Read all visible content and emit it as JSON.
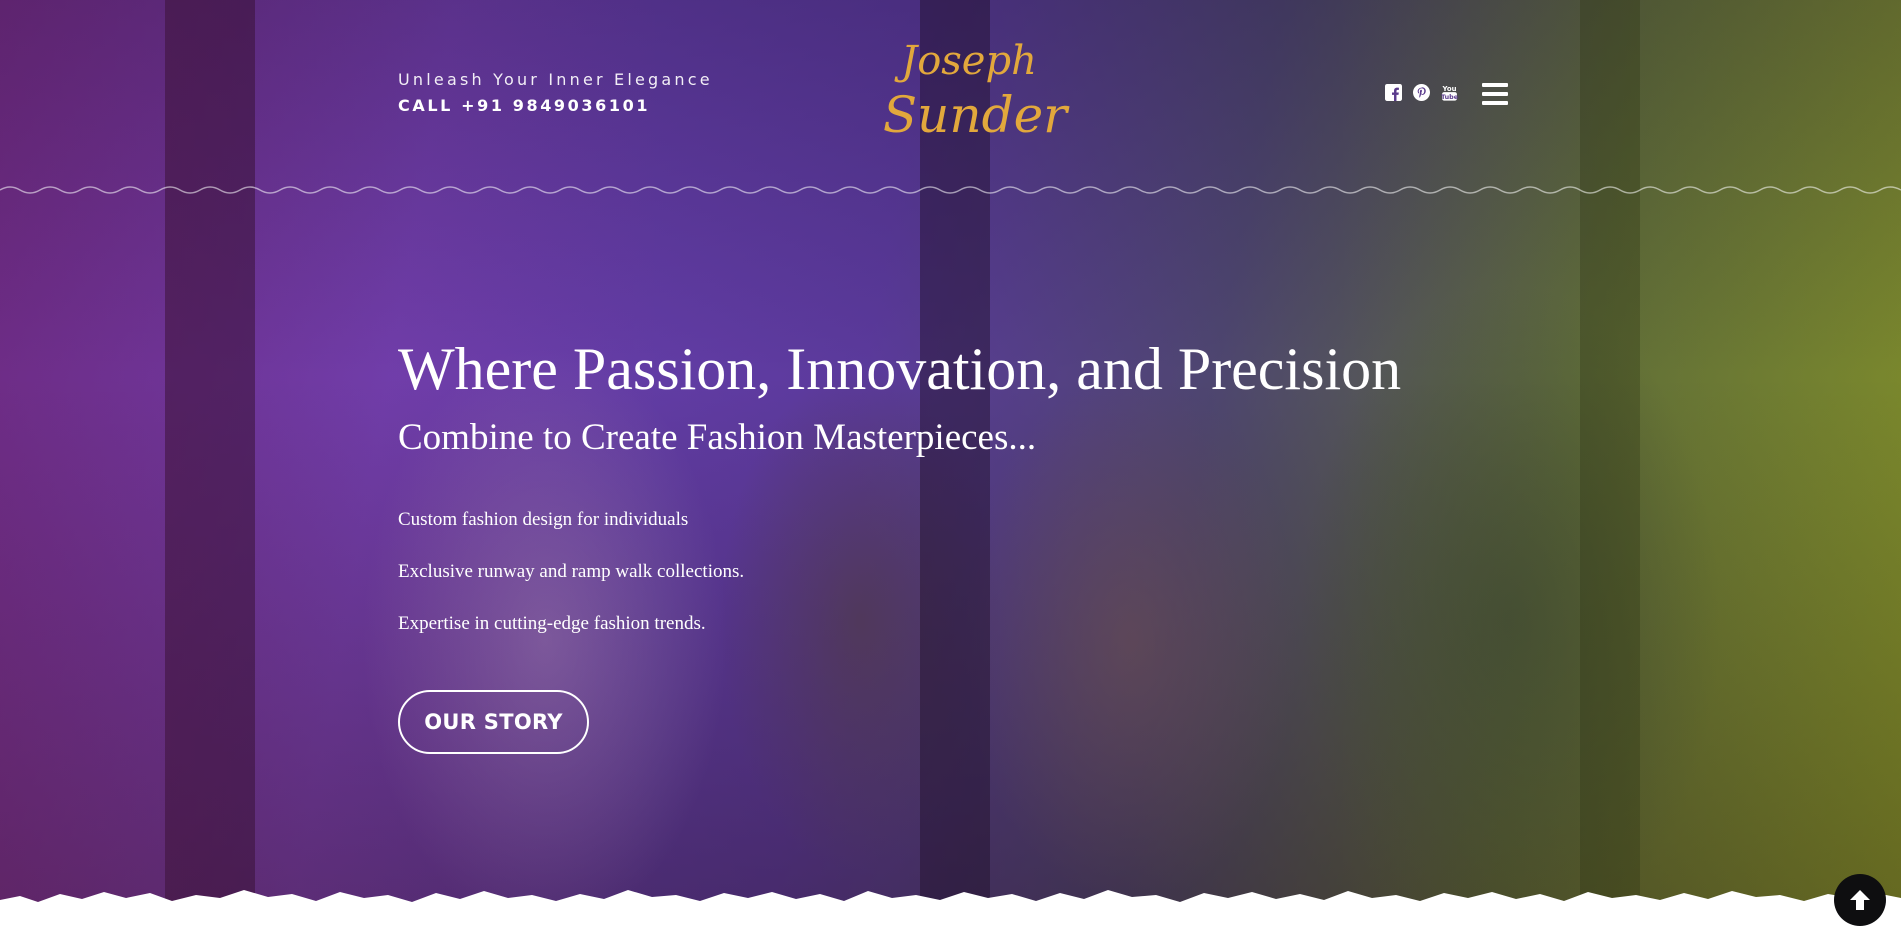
{
  "header": {
    "tagline": "Unleash Your Inner Elegance",
    "phone": "CALL +91 9849036101",
    "logo": {
      "line1": "Joseph",
      "line2": "Sunder",
      "color": "#e2a83c"
    },
    "socials": [
      {
        "name": "facebook-icon"
      },
      {
        "name": "pinterest-icon"
      },
      {
        "name": "youtube-icon"
      }
    ],
    "menu_icon": "hamburger-menu-icon"
  },
  "hero": {
    "headline": "Where Passion, Innovation, and Precision",
    "subheadline": "Combine to Create Fashion Masterpieces...",
    "features": [
      "Custom fashion design for individuals",
      "Exclusive runway and ramp walk collections.",
      "Expertise in cutting-edge fashion trends."
    ],
    "cta_label": "OUR STORY"
  },
  "scroll_top_icon": "arrow-up-icon",
  "colors": {
    "overlay_purple": "#6a3fb0",
    "overlay_olive": "#7c8a2a",
    "text": "#ffffff",
    "scroll_button": "#0e0e10"
  }
}
